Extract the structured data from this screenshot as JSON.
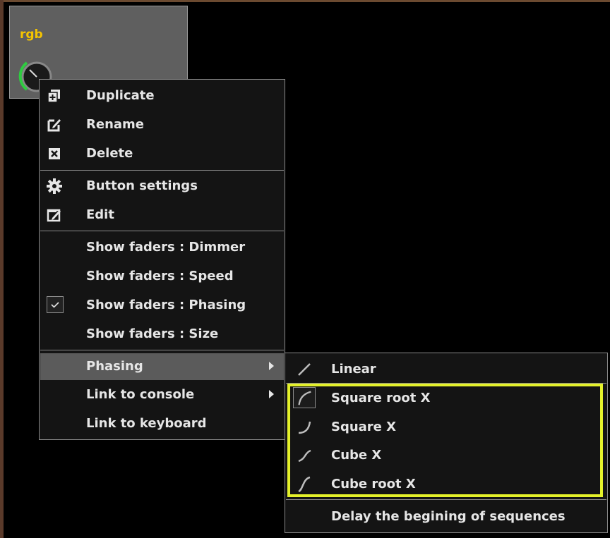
{
  "tile": {
    "label": "rgb"
  },
  "main_menu": {
    "items": [
      {
        "label": "Duplicate",
        "icon": "duplicate-icon"
      },
      {
        "label": "Rename",
        "icon": "rename-icon"
      },
      {
        "label": "Delete",
        "icon": "delete-icon"
      },
      {
        "label": "Button settings",
        "icon": "gear-icon"
      },
      {
        "label": "Edit",
        "icon": "edit-icon"
      },
      {
        "label": "Show faders : Dimmer"
      },
      {
        "label": "Show faders : Speed"
      },
      {
        "label": "Show faders : Phasing",
        "checked": true
      },
      {
        "label": "Show faders : Size"
      },
      {
        "label": "Phasing",
        "submenu": true,
        "highlighted": true
      },
      {
        "label": "Link to console",
        "submenu": true
      },
      {
        "label": "Link to keyboard"
      }
    ]
  },
  "sub_menu": {
    "items": [
      {
        "label": "Linear",
        "icon": "linear-curve-icon"
      },
      {
        "label": "Square root X",
        "icon": "square-root-curve-icon",
        "selected": true
      },
      {
        "label": "Square X",
        "icon": "square-curve-icon"
      },
      {
        "label": "Cube X",
        "icon": "cube-curve-icon"
      },
      {
        "label": "Cube root X",
        "icon": "cube-root-curve-icon"
      },
      {
        "label": "Delay the begining of sequences"
      }
    ]
  },
  "colors": {
    "accent": "#f5c400",
    "highlight_box": "#e4f12a",
    "menu_bg": "#141414",
    "hover_bg": "#5b5b5b"
  }
}
